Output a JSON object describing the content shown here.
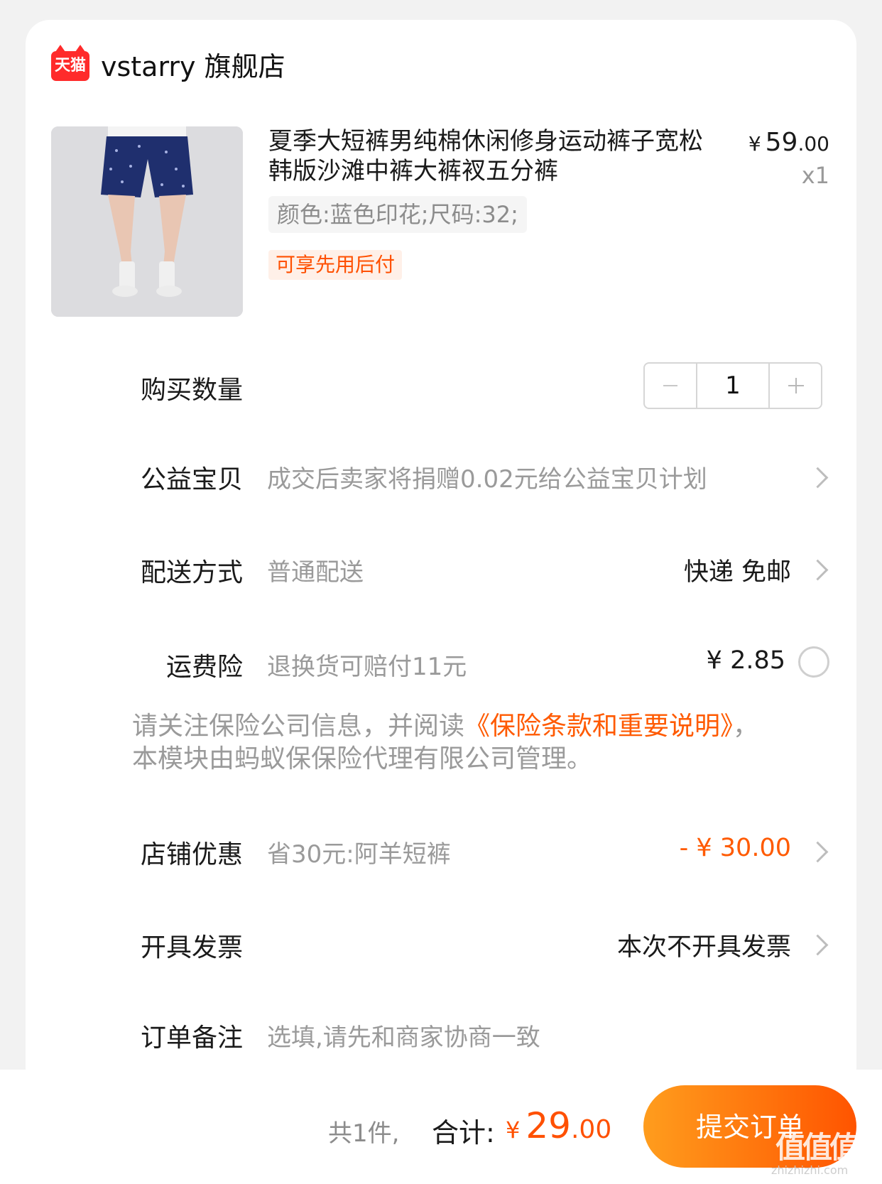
{
  "shop": {
    "logo_text": "天猫",
    "name": "vstarry 旗舰店"
  },
  "product": {
    "title": "夏季大短裤男纯棉休闲修身运动裤子宽松韩版沙滩中裤大裤衩五分裤",
    "price_symbol": "¥",
    "price_int": "59",
    "price_dec": ".00",
    "qty_label": "x1",
    "sku": "颜色:蓝色印花;尺码:32;",
    "tag": "可享先用后付"
  },
  "rows": {
    "quantity": {
      "label": "购买数量",
      "value": "1"
    },
    "charity": {
      "label": "公益宝贝",
      "desc": "成交后卖家将捐赠0.02元给公益宝贝计划"
    },
    "delivery": {
      "label": "配送方式",
      "desc": "普通配送",
      "value": "快递 免邮"
    },
    "insurance": {
      "label": "运费险",
      "desc": "退换货可赔付11元",
      "value": "¥ 2.85"
    },
    "notice_prefix": "请关注保险公司信息，并阅读",
    "notice_link": "《保险条款和重要说明》",
    "notice_suffix": "，本模块由蚂蚁保保险代理有限公司管理。",
    "shop_discount": {
      "label": "店铺优惠",
      "desc": "省30元:阿羊短裤",
      "value": "- ¥ 30.00"
    },
    "invoice": {
      "label": "开具发票",
      "value": "本次不开具发票"
    },
    "remark": {
      "label": "订单备注",
      "placeholder": "选填,请先和商家协商一致"
    }
  },
  "footer": {
    "count": "共1件,",
    "total_label": "合计:",
    "total_symbol": "¥",
    "total_int": "29",
    "total_dec": ".00",
    "submit_label": "提交订单"
  },
  "watermark": {
    "text": "值值值",
    "url": "zhizhizhi.com"
  },
  "colors": {
    "accent": "#ff5000",
    "muted": "#9a9a9a",
    "button_start": "#ff9d1d",
    "button_end": "#ff5400"
  }
}
